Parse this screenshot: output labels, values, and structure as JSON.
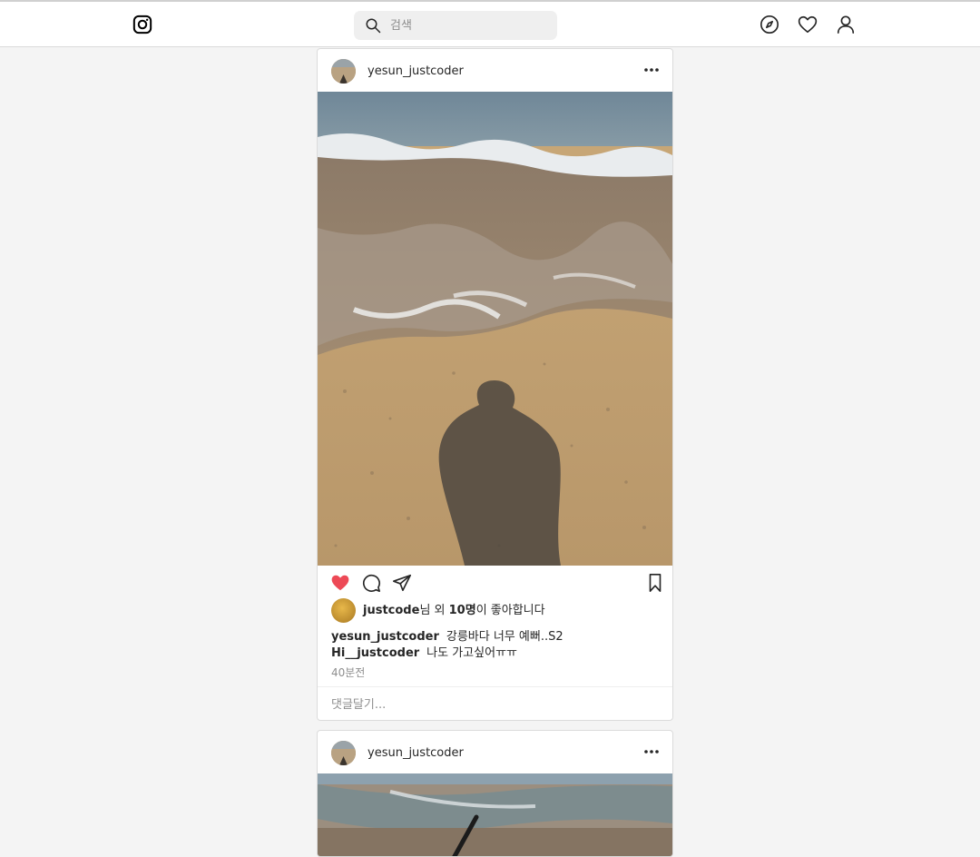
{
  "header": {
    "logo_icon": "instagram-icon",
    "search": {
      "placeholder": "검색",
      "value": "",
      "icon": "search-icon"
    },
    "nav": [
      {
        "name": "explore",
        "icon": "compass-icon"
      },
      {
        "name": "activity",
        "icon": "heart-icon"
      },
      {
        "name": "profile",
        "icon": "user-icon"
      }
    ]
  },
  "posts": [
    {
      "username": "yesun_justcoder",
      "liked": true,
      "like_color": "#ed4956",
      "likes": {
        "user": "justcode",
        "suffix1": "님 외 ",
        "count": "10명",
        "suffix2": "이 좋아합니다"
      },
      "comments": [
        {
          "user": "yesun_justcoder",
          "text": "강릉바다 너무 예뻐..S2"
        },
        {
          "user": "Hi__justcoder",
          "text": "나도 가고싶어ㅠㅠ"
        }
      ],
      "time": "40분전",
      "comment_placeholder": "댓글달기..."
    },
    {
      "username": "yesun_justcoder"
    }
  ]
}
